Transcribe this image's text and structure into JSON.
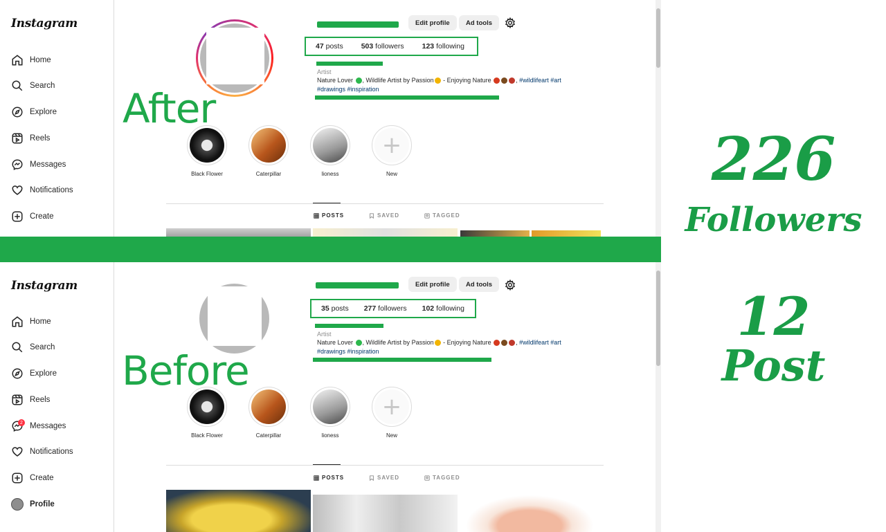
{
  "after_panel": {
    "logo": "Instagram",
    "nav": [
      {
        "label": "Home",
        "icon": "home-icon"
      },
      {
        "label": "Search",
        "icon": "search-icon"
      },
      {
        "label": "Explore",
        "icon": "explore-icon"
      },
      {
        "label": "Reels",
        "icon": "reels-icon"
      },
      {
        "label": "Messages",
        "icon": "messages-icon"
      },
      {
        "label": "Notifications",
        "icon": "heart-icon"
      },
      {
        "label": "Create",
        "icon": "plus-square-icon"
      }
    ],
    "overlay_label": "After",
    "buttons": {
      "edit_profile": "Edit profile",
      "ad_tools": "Ad tools"
    },
    "stats": {
      "posts_count": "47",
      "posts_label": "posts",
      "followers_count": "503",
      "followers_label": "followers",
      "following_count": "123",
      "following_label": "following"
    },
    "bio": {
      "category": "Artist",
      "line1_a": "Nature Lover",
      "line1_b": ", Wildlife Artist by Passion",
      "line1_c": " - Enjoying Nature",
      "line1_tag": "#wildlifeart #art",
      "line2": "#drawings #inspiration"
    },
    "highlights": [
      "Black Flower",
      "Caterpillar",
      "lioness",
      "New"
    ],
    "tabs": {
      "posts": "POSTS",
      "saved": "SAVED",
      "tagged": "TAGGED"
    }
  },
  "before_panel": {
    "logo": "Instagram",
    "nav": [
      {
        "label": "Home",
        "icon": "home-icon"
      },
      {
        "label": "Search",
        "icon": "search-icon"
      },
      {
        "label": "Explore",
        "icon": "explore-icon"
      },
      {
        "label": "Reels",
        "icon": "reels-icon"
      },
      {
        "label": "Messages",
        "icon": "messages-icon",
        "badge": "2"
      },
      {
        "label": "Notifications",
        "icon": "heart-icon"
      },
      {
        "label": "Create",
        "icon": "plus-square-icon"
      },
      {
        "label": "Profile",
        "icon": "avatar"
      }
    ],
    "overlay_label": "Before",
    "buttons": {
      "edit_profile": "Edit profile",
      "ad_tools": "Ad tools"
    },
    "stats": {
      "posts_count": "35",
      "posts_label": "posts",
      "followers_count": "277",
      "followers_label": "followers",
      "following_count": "102",
      "following_label": "following"
    },
    "bio": {
      "category": "Artist",
      "line1_a": "Nature Lover",
      "line1_b": ", Wildlife Artist by Passion",
      "line1_c": " - Enjoying Nature",
      "line1_tag": "#wildlifeart #art",
      "line2": "#drawings #inspiration"
    },
    "highlights": [
      "Black Flower",
      "Caterpillar",
      "lioness",
      "New"
    ],
    "tabs": {
      "posts": "POSTS",
      "saved": "SAVED",
      "tagged": "TAGGED"
    }
  },
  "summary": {
    "followers_gain": "226",
    "followers_word": "Followers",
    "posts_gain": "12",
    "posts_word": "Post"
  },
  "colors": {
    "accent_green": "#1fa84a",
    "summary_green": "#1a9d47"
  }
}
